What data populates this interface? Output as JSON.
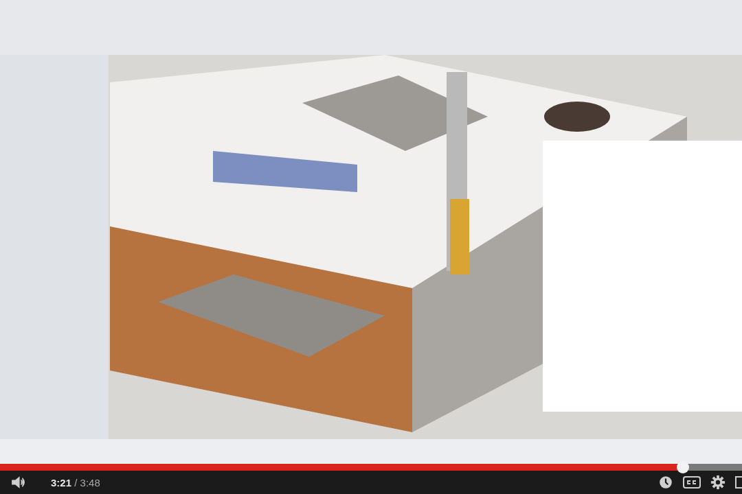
{
  "player": {
    "progress": {
      "level": 0.92
    },
    "current_time": "3:21",
    "separator": "/",
    "duration": "3:48"
  }
}
